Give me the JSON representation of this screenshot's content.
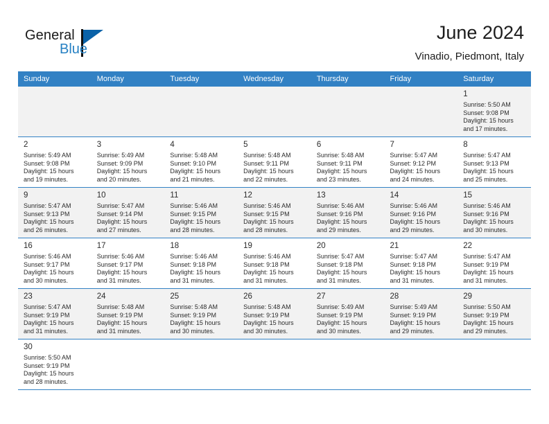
{
  "brand": {
    "name_part1": "General",
    "name_part2": "Blue",
    "triangle_color": "#0a62a8",
    "blue_text_color": "#2580c3"
  },
  "header": {
    "title": "June 2024",
    "subtitle": "Vinadio, Piedmont, Italy"
  },
  "theme": {
    "header_row_bg": "#3281c4",
    "header_row_text": "#ffffff",
    "row_alt_bg": "#f2f2f2",
    "cell_border": "#3281c4",
    "text_color": "#2b2b2b"
  },
  "weekday_headers": [
    "Sunday",
    "Monday",
    "Tuesday",
    "Wednesday",
    "Thursday",
    "Friday",
    "Saturday"
  ],
  "weeks": [
    [
      {
        "day": "",
        "sunrise": "",
        "sunset": "",
        "daylight1": "",
        "daylight2": ""
      },
      {
        "day": "",
        "sunrise": "",
        "sunset": "",
        "daylight1": "",
        "daylight2": ""
      },
      {
        "day": "",
        "sunrise": "",
        "sunset": "",
        "daylight1": "",
        "daylight2": ""
      },
      {
        "day": "",
        "sunrise": "",
        "sunset": "",
        "daylight1": "",
        "daylight2": ""
      },
      {
        "day": "",
        "sunrise": "",
        "sunset": "",
        "daylight1": "",
        "daylight2": ""
      },
      {
        "day": "",
        "sunrise": "",
        "sunset": "",
        "daylight1": "",
        "daylight2": ""
      },
      {
        "day": "1",
        "sunrise": "Sunrise: 5:50 AM",
        "sunset": "Sunset: 9:08 PM",
        "daylight1": "Daylight: 15 hours",
        "daylight2": "and 17 minutes."
      }
    ],
    [
      {
        "day": "2",
        "sunrise": "Sunrise: 5:49 AM",
        "sunset": "Sunset: 9:08 PM",
        "daylight1": "Daylight: 15 hours",
        "daylight2": "and 19 minutes."
      },
      {
        "day": "3",
        "sunrise": "Sunrise: 5:49 AM",
        "sunset": "Sunset: 9:09 PM",
        "daylight1": "Daylight: 15 hours",
        "daylight2": "and 20 minutes."
      },
      {
        "day": "4",
        "sunrise": "Sunrise: 5:48 AM",
        "sunset": "Sunset: 9:10 PM",
        "daylight1": "Daylight: 15 hours",
        "daylight2": "and 21 minutes."
      },
      {
        "day": "5",
        "sunrise": "Sunrise: 5:48 AM",
        "sunset": "Sunset: 9:11 PM",
        "daylight1": "Daylight: 15 hours",
        "daylight2": "and 22 minutes."
      },
      {
        "day": "6",
        "sunrise": "Sunrise: 5:48 AM",
        "sunset": "Sunset: 9:11 PM",
        "daylight1": "Daylight: 15 hours",
        "daylight2": "and 23 minutes."
      },
      {
        "day": "7",
        "sunrise": "Sunrise: 5:47 AM",
        "sunset": "Sunset: 9:12 PM",
        "daylight1": "Daylight: 15 hours",
        "daylight2": "and 24 minutes."
      },
      {
        "day": "8",
        "sunrise": "Sunrise: 5:47 AM",
        "sunset": "Sunset: 9:13 PM",
        "daylight1": "Daylight: 15 hours",
        "daylight2": "and 25 minutes."
      }
    ],
    [
      {
        "day": "9",
        "sunrise": "Sunrise: 5:47 AM",
        "sunset": "Sunset: 9:13 PM",
        "daylight1": "Daylight: 15 hours",
        "daylight2": "and 26 minutes."
      },
      {
        "day": "10",
        "sunrise": "Sunrise: 5:47 AM",
        "sunset": "Sunset: 9:14 PM",
        "daylight1": "Daylight: 15 hours",
        "daylight2": "and 27 minutes."
      },
      {
        "day": "11",
        "sunrise": "Sunrise: 5:46 AM",
        "sunset": "Sunset: 9:15 PM",
        "daylight1": "Daylight: 15 hours",
        "daylight2": "and 28 minutes."
      },
      {
        "day": "12",
        "sunrise": "Sunrise: 5:46 AM",
        "sunset": "Sunset: 9:15 PM",
        "daylight1": "Daylight: 15 hours",
        "daylight2": "and 28 minutes."
      },
      {
        "day": "13",
        "sunrise": "Sunrise: 5:46 AM",
        "sunset": "Sunset: 9:16 PM",
        "daylight1": "Daylight: 15 hours",
        "daylight2": "and 29 minutes."
      },
      {
        "day": "14",
        "sunrise": "Sunrise: 5:46 AM",
        "sunset": "Sunset: 9:16 PM",
        "daylight1": "Daylight: 15 hours",
        "daylight2": "and 29 minutes."
      },
      {
        "day": "15",
        "sunrise": "Sunrise: 5:46 AM",
        "sunset": "Sunset: 9:16 PM",
        "daylight1": "Daylight: 15 hours",
        "daylight2": "and 30 minutes."
      }
    ],
    [
      {
        "day": "16",
        "sunrise": "Sunrise: 5:46 AM",
        "sunset": "Sunset: 9:17 PM",
        "daylight1": "Daylight: 15 hours",
        "daylight2": "and 30 minutes."
      },
      {
        "day": "17",
        "sunrise": "Sunrise: 5:46 AM",
        "sunset": "Sunset: 9:17 PM",
        "daylight1": "Daylight: 15 hours",
        "daylight2": "and 31 minutes."
      },
      {
        "day": "18",
        "sunrise": "Sunrise: 5:46 AM",
        "sunset": "Sunset: 9:18 PM",
        "daylight1": "Daylight: 15 hours",
        "daylight2": "and 31 minutes."
      },
      {
        "day": "19",
        "sunrise": "Sunrise: 5:46 AM",
        "sunset": "Sunset: 9:18 PM",
        "daylight1": "Daylight: 15 hours",
        "daylight2": "and 31 minutes."
      },
      {
        "day": "20",
        "sunrise": "Sunrise: 5:47 AM",
        "sunset": "Sunset: 9:18 PM",
        "daylight1": "Daylight: 15 hours",
        "daylight2": "and 31 minutes."
      },
      {
        "day": "21",
        "sunrise": "Sunrise: 5:47 AM",
        "sunset": "Sunset: 9:18 PM",
        "daylight1": "Daylight: 15 hours",
        "daylight2": "and 31 minutes."
      },
      {
        "day": "22",
        "sunrise": "Sunrise: 5:47 AM",
        "sunset": "Sunset: 9:19 PM",
        "daylight1": "Daylight: 15 hours",
        "daylight2": "and 31 minutes."
      }
    ],
    [
      {
        "day": "23",
        "sunrise": "Sunrise: 5:47 AM",
        "sunset": "Sunset: 9:19 PM",
        "daylight1": "Daylight: 15 hours",
        "daylight2": "and 31 minutes."
      },
      {
        "day": "24",
        "sunrise": "Sunrise: 5:48 AM",
        "sunset": "Sunset: 9:19 PM",
        "daylight1": "Daylight: 15 hours",
        "daylight2": "and 31 minutes."
      },
      {
        "day": "25",
        "sunrise": "Sunrise: 5:48 AM",
        "sunset": "Sunset: 9:19 PM",
        "daylight1": "Daylight: 15 hours",
        "daylight2": "and 30 minutes."
      },
      {
        "day": "26",
        "sunrise": "Sunrise: 5:48 AM",
        "sunset": "Sunset: 9:19 PM",
        "daylight1": "Daylight: 15 hours",
        "daylight2": "and 30 minutes."
      },
      {
        "day": "27",
        "sunrise": "Sunrise: 5:49 AM",
        "sunset": "Sunset: 9:19 PM",
        "daylight1": "Daylight: 15 hours",
        "daylight2": "and 30 minutes."
      },
      {
        "day": "28",
        "sunrise": "Sunrise: 5:49 AM",
        "sunset": "Sunset: 9:19 PM",
        "daylight1": "Daylight: 15 hours",
        "daylight2": "and 29 minutes."
      },
      {
        "day": "29",
        "sunrise": "Sunrise: 5:50 AM",
        "sunset": "Sunset: 9:19 PM",
        "daylight1": "Daylight: 15 hours",
        "daylight2": "and 29 minutes."
      }
    ],
    [
      {
        "day": "30",
        "sunrise": "Sunrise: 5:50 AM",
        "sunset": "Sunset: 9:19 PM",
        "daylight1": "Daylight: 15 hours",
        "daylight2": "and 28 minutes."
      },
      {
        "day": "",
        "sunrise": "",
        "sunset": "",
        "daylight1": "",
        "daylight2": ""
      },
      {
        "day": "",
        "sunrise": "",
        "sunset": "",
        "daylight1": "",
        "daylight2": ""
      },
      {
        "day": "",
        "sunrise": "",
        "sunset": "",
        "daylight1": "",
        "daylight2": ""
      },
      {
        "day": "",
        "sunrise": "",
        "sunset": "",
        "daylight1": "",
        "daylight2": ""
      },
      {
        "day": "",
        "sunrise": "",
        "sunset": "",
        "daylight1": "",
        "daylight2": ""
      },
      {
        "day": "",
        "sunrise": "",
        "sunset": "",
        "daylight1": "",
        "daylight2": ""
      }
    ]
  ]
}
